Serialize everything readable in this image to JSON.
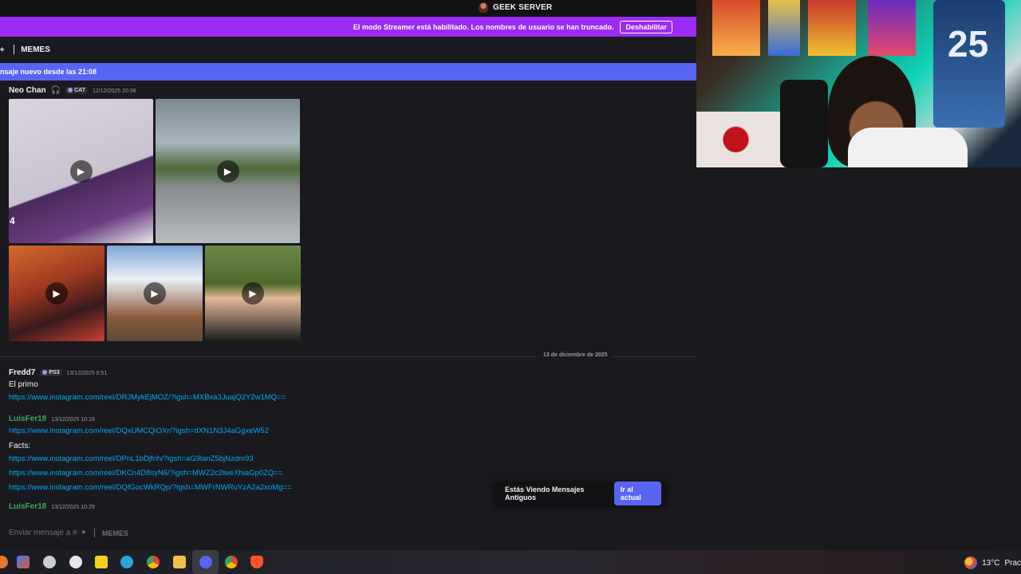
{
  "window": {
    "server_name": "GEEK SERVER"
  },
  "streamer_banner": {
    "message": "El modo Streamer está habilitado. Los nombres de usuario se han truncado.",
    "disable_label": "Deshabilitar"
  },
  "channel": {
    "name": "MEMES"
  },
  "new_messages_bar": {
    "label": "nsaje nuevo desde las 21:08"
  },
  "webcam": {
    "jersey_number": "25"
  },
  "message_1": {
    "author": "Neo Chan",
    "author_color": "#f2f3f5",
    "tag": "CAT",
    "timestamp": "12/12/2025 20:38",
    "overlay_count": "4"
  },
  "date_divider": {
    "label": "13 de diciembre de 2025"
  },
  "message_2": {
    "author": "Fredd7",
    "author_color": "#f2f3f5",
    "tag": "PS3",
    "timestamp": "13/12/2025 0:51",
    "text": "El primo",
    "links": [
      "https://www.instagram.com/reel/DRJMykEjMOZ/?igsh=MXBxa3JuajQ2Y2w1MQ=="
    ]
  },
  "message_3": {
    "author": "LuisFer18",
    "author_color": "#3ba55d",
    "timestamp": "13/12/2025 10:19",
    "link_1": "https://www.instagram.com/reel/DQxUMCQiOXr/?igsh=dXN1N3J4aGgxeW52",
    "text": "Facts:",
    "links": [
      "https://www.instagram.com/reel/DPnL1bDjfnh/?igsh=aG9lanZ5bjNzdm93",
      "https://www.instagram.com/reel/DKCn4D8syN6/?igsh=MWZ2c2lweXhiaGp0ZQ==",
      "https://www.instagram.com/reel/DQfGocWkRQp/?igsh=MWFrNWRuYzA2a2xoMg=="
    ]
  },
  "message_4": {
    "author": "LuisFer18",
    "author_color": "#3ba55d",
    "timestamp": "13/12/2025 10:29"
  },
  "old_messages_toast": {
    "text": "Estás Viendo Mensajes Antiguos",
    "button": "Ir al actual"
  },
  "composer": {
    "placeholder": "Enviar mensaje a #",
    "channel": "MEMES"
  },
  "taskbar": {
    "temperature": "13°C",
    "condition": "Prac"
  }
}
